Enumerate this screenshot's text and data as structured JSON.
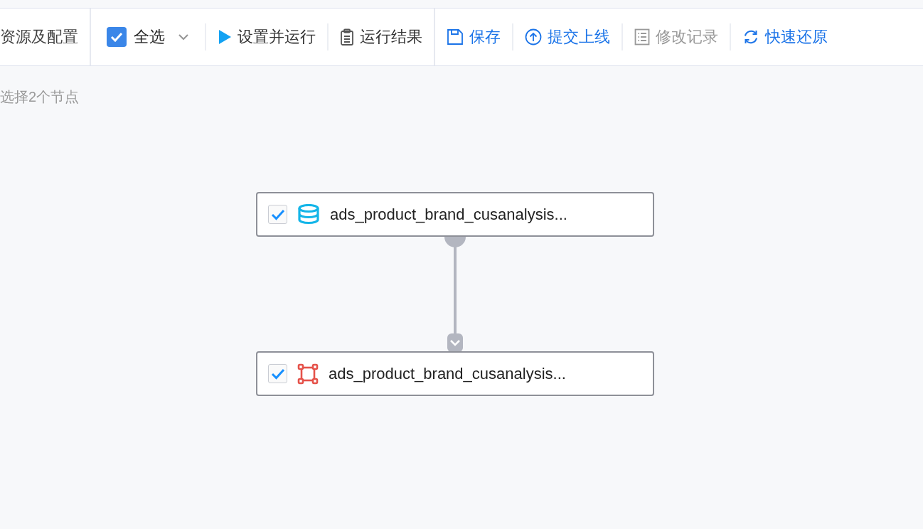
{
  "toolbar": {
    "tab_label": "资源及配置",
    "select_all": {
      "label": "全选",
      "checked": true
    },
    "action_groups": [
      [
        {
          "label": "设置并运行",
          "kind": "run",
          "color": "#333333",
          "disabled": false
        },
        {
          "label": "运行结果",
          "kind": "result",
          "color": "#333333",
          "disabled": false
        }
      ],
      [
        {
          "label": "保存",
          "kind": "save",
          "color": "#1a73e8",
          "disabled": false
        },
        {
          "label": "提交上线",
          "kind": "submit",
          "color": "#1a73e8",
          "disabled": false
        },
        {
          "label": "修改记录",
          "kind": "history",
          "disabled": true
        },
        {
          "label": "快速还原",
          "kind": "restore",
          "color": "#1a73e8",
          "disabled": false
        }
      ]
    ]
  },
  "selection_status": "选择2个节点",
  "nodes": [
    {
      "label": "ads_product_brand_cusanalysis...",
      "kind": "table",
      "checked": true
    },
    {
      "label": "ads_product_brand_cusanalysis...",
      "kind": "model",
      "checked": true
    }
  ]
}
